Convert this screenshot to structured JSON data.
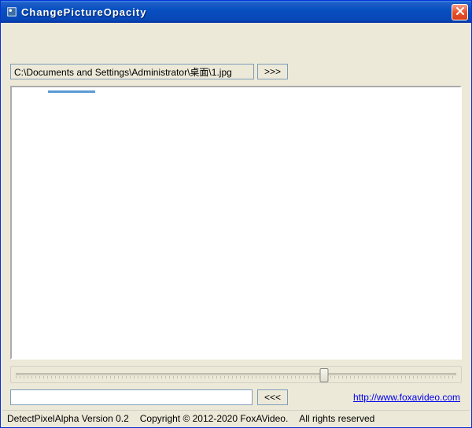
{
  "window": {
    "title": "ChangePictureOpacity"
  },
  "path": {
    "value": "C:\\Documents and Settings\\Administrator\\桌面\\1.jpg",
    "browse_label": ">>>"
  },
  "slider": {
    "position_percent": 70
  },
  "output": {
    "value": "",
    "process_label": "<<<"
  },
  "footer": {
    "url_label": "http://www.foxavideo.com"
  },
  "status": {
    "version": "DetectPixelAlpha Version 0.2",
    "copyright": "Copyright © 2012-2020 FoxAVideo.",
    "rights": "All rights reserved"
  },
  "colors": {
    "titlebar_blue": "#0850c2",
    "close_red": "#d73f1a",
    "panel_bg": "#ece9d8"
  }
}
